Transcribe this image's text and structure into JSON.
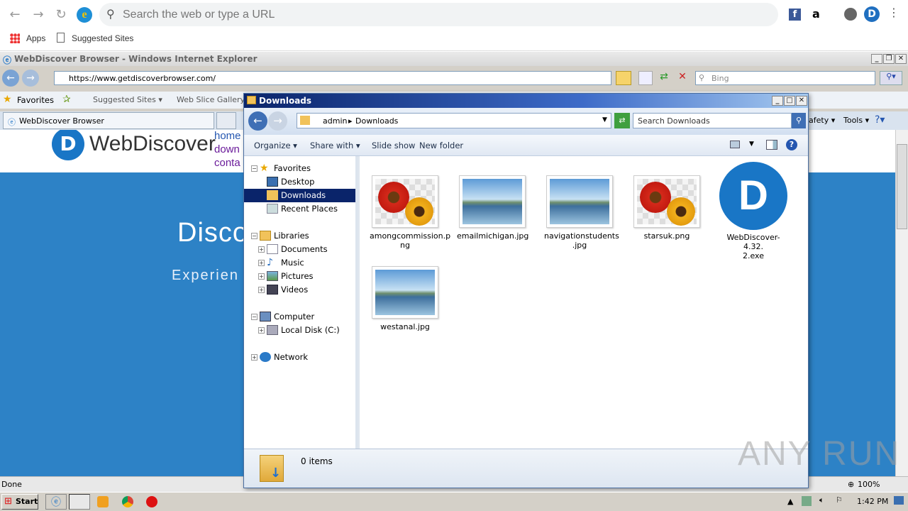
{
  "chrome": {
    "omnibox_placeholder": "Search the web or type a URL",
    "bookmarks": [
      "Apps",
      "Suggested Sites"
    ]
  },
  "ie": {
    "title": "WebDiscover Browser - Windows Internet Explorer",
    "url": "https://www.getdiscoverbrowser.com/",
    "search_placeholder": "Bing",
    "favorites_label": "Favorites",
    "fav_links": [
      "Suggested Sites ▾",
      "Web Slice Gallery ▾"
    ],
    "tab_title": "WebDiscover Browser",
    "menu": [
      "afety ▾",
      "Tools ▾"
    ],
    "status": "Done",
    "zoom": "100%"
  },
  "site": {
    "brand": "WebDiscover",
    "nav": [
      "home",
      "down",
      "conta"
    ],
    "hero_title": "Disco",
    "hero_sub": "Experien"
  },
  "explorer": {
    "title": "Downloads",
    "breadcrumb": [
      "admin",
      "Downloads"
    ],
    "search_placeholder": "Search Downloads",
    "commands": [
      "Organize ▾",
      "Share with ▾",
      "Slide show",
      "New folder"
    ],
    "tree": [
      {
        "label": "Favorites"
      },
      {
        "label": "Desktop"
      },
      {
        "label": "Downloads"
      },
      {
        "label": "Recent Places"
      },
      {
        "label": "Libraries"
      },
      {
        "label": "Documents"
      },
      {
        "label": "Music"
      },
      {
        "label": "Pictures"
      },
      {
        "label": "Videos"
      },
      {
        "label": "Computer"
      },
      {
        "label": "Local Disk (C:)"
      },
      {
        "label": "Network"
      }
    ],
    "files": [
      {
        "name": "amongcommission.png",
        "kind": "flower"
      },
      {
        "name": "emailmichigan.jpg",
        "kind": "lake"
      },
      {
        "name": "navigationstudents.jpg",
        "kind": "lake"
      },
      {
        "name": "starsuk.png",
        "kind": "flower"
      },
      {
        "name": "WebDiscover-4.32.2.exe",
        "kind": "exe"
      },
      {
        "name": "westanal.jpg",
        "kind": "lake"
      }
    ],
    "file_labels": [
      [
        "amongcommission.p",
        "ng"
      ],
      [
        "emailmichigan.jpg"
      ],
      [
        "navigationstudents",
        ".jpg"
      ],
      [
        "starsuk.png"
      ],
      [
        "WebDiscover-4.32.",
        "2.exe"
      ],
      [
        "westanal.jpg"
      ]
    ],
    "item_count": "0 items"
  },
  "taskbar": {
    "start": "Start",
    "clock": "1:42 PM"
  },
  "watermark": "ANY RUN"
}
